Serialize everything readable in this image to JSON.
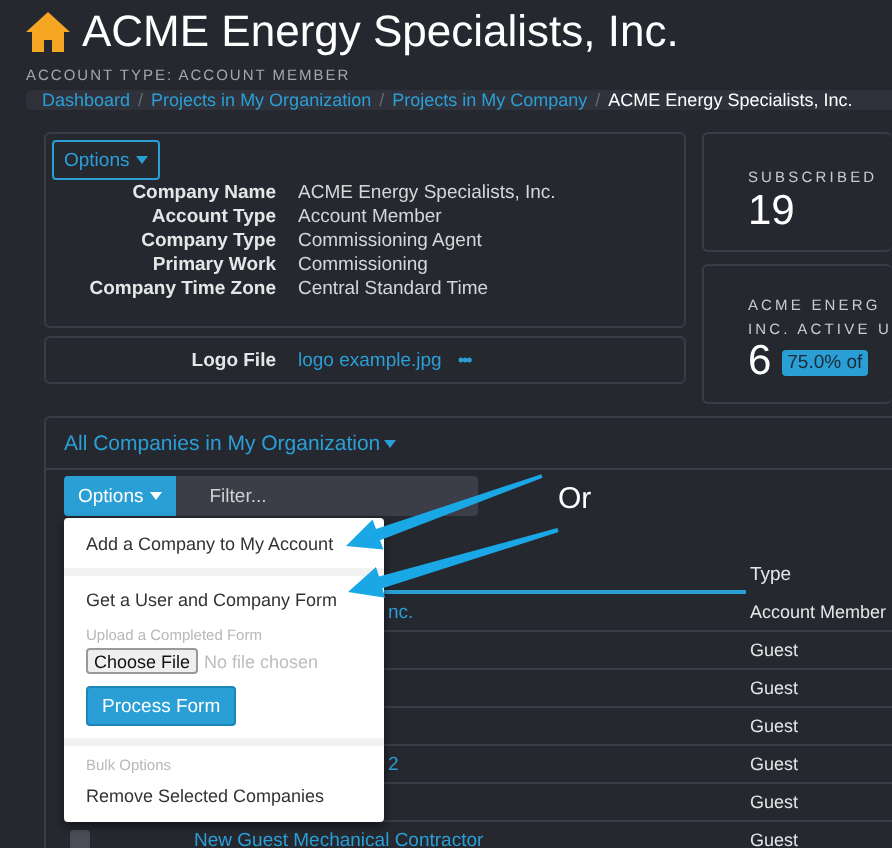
{
  "header": {
    "title": "ACME Energy Specialists, Inc.",
    "subtitle": "ACCOUNT TYPE: ACCOUNT MEMBER"
  },
  "breadcrumb_separator": "/",
  "breadcrumbs": [
    {
      "label": "Dashboard",
      "current": false
    },
    {
      "label": "Projects in My Organization",
      "current": false
    },
    {
      "label": "Projects in My Company",
      "current": false
    },
    {
      "label": "ACME Energy Specialists, Inc.",
      "current": true
    }
  ],
  "company_card": {
    "options_button": "Options",
    "details": [
      {
        "label": "Company Name",
        "value": "ACME Energy Specialists, Inc."
      },
      {
        "label": "Account Type",
        "value": "Account Member"
      },
      {
        "label": "Company Type",
        "value": "Commissioning Agent"
      },
      {
        "label": "Primary Work",
        "value": "Commissioning"
      },
      {
        "label": "Company Time Zone",
        "value": "Central Standard Time"
      }
    ]
  },
  "logo_card": {
    "label": "Logo File",
    "link": "logo example.jpg",
    "more": "•••"
  },
  "stats": [
    {
      "kind": "plain",
      "title": [
        "SUBSCRIBED"
      ],
      "value": "19"
    },
    {
      "kind": "badge",
      "title": [
        "ACME ENERG",
        "INC. ACTIVE U"
      ],
      "value": "6",
      "badge": "75.0% of"
    }
  ],
  "companies_panel": {
    "title": "All Companies in My Organization",
    "options_button": "Options",
    "filter": {
      "placeholder": "Filter..."
    },
    "annotation": "Or",
    "menu": [
      {
        "kind": "item",
        "label": "Add a Company to My Account"
      },
      {
        "kind": "divider"
      },
      {
        "kind": "item",
        "label": "Get a User and Company Form"
      },
      {
        "kind": "header",
        "label": "Upload a Completed Form"
      },
      {
        "kind": "file",
        "button": "Choose File",
        "status": "No file chosen"
      },
      {
        "kind": "action",
        "label": "Process Form"
      },
      {
        "kind": "divider"
      },
      {
        "kind": "header",
        "label": "Bulk Options"
      },
      {
        "kind": "item",
        "label": "Remove Selected Companies"
      }
    ],
    "columns": [
      "Type"
    ],
    "rows": [
      {
        "kind": "partial",
        "name": "nc.",
        "type": "Account Member"
      },
      {
        "kind": "hidden",
        "type": "Guest"
      },
      {
        "kind": "hidden",
        "type": "Guest"
      },
      {
        "kind": "hidden",
        "type": "Guest"
      },
      {
        "kind": "partial",
        "name": "2",
        "type": "Guest"
      },
      {
        "kind": "hidden",
        "type": "Guest"
      },
      {
        "kind": "full",
        "name": "New Guest Mechanical Contractor",
        "type": "Guest",
        "checked": false
      }
    ]
  }
}
